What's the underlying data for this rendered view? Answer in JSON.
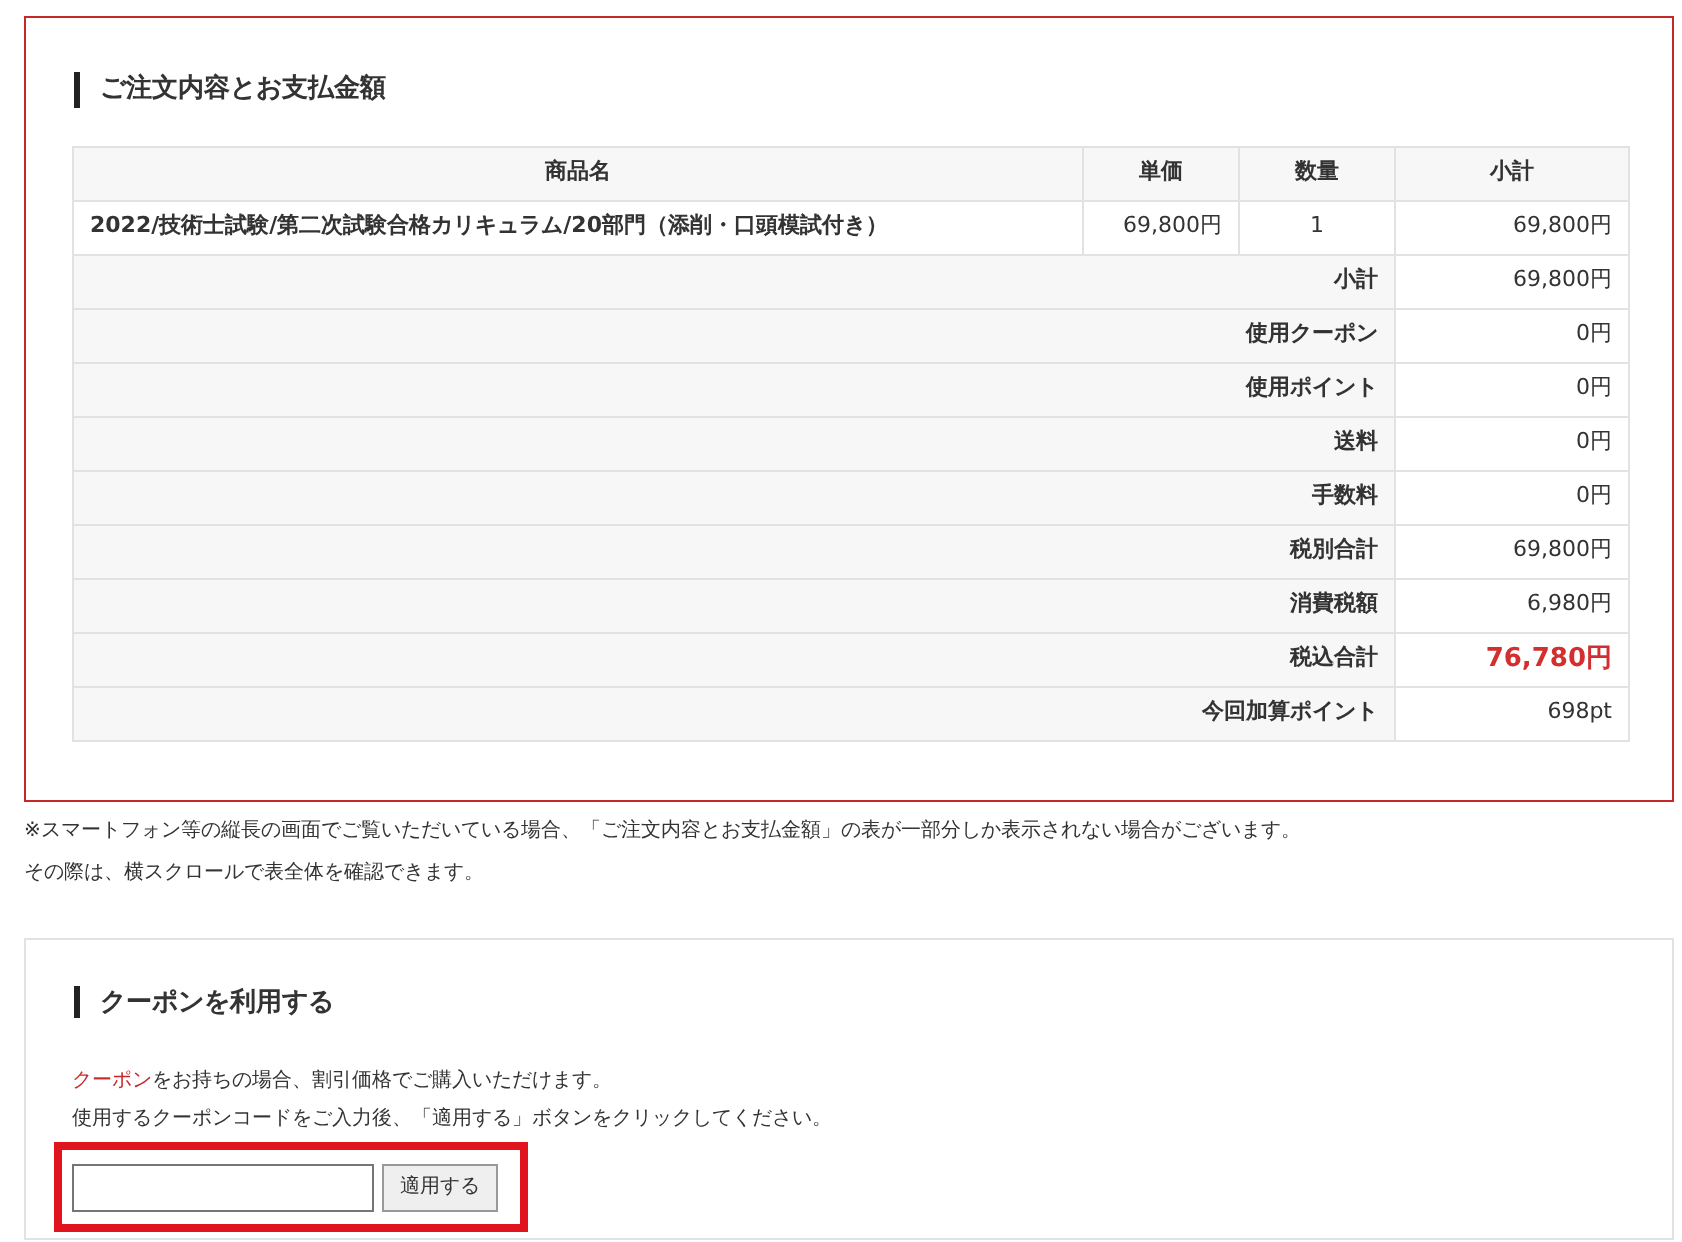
{
  "order": {
    "title": "ご注文内容とお支払金額",
    "columns": [
      "商品名",
      "単価",
      "数量",
      "小計"
    ],
    "items": [
      {
        "name": "2022/技術士試験/第二次試験合格カリキュラム/20部門（添削・口頭模試付き）",
        "price": "69,800円",
        "quantity": "1",
        "subtotal": "69,800円"
      }
    ],
    "summary": [
      {
        "label": "小計",
        "value": "69,800円",
        "highlight": false
      },
      {
        "label": "使用クーポン",
        "value": "0円",
        "highlight": false
      },
      {
        "label": "使用ポイント",
        "value": "0円",
        "highlight": false
      },
      {
        "label": "送料",
        "value": "0円",
        "highlight": false
      },
      {
        "label": "手数料",
        "value": "0円",
        "highlight": false
      },
      {
        "label": "税別合計",
        "value": "69,800円",
        "highlight": false
      },
      {
        "label": "消費税額",
        "value": "6,980円",
        "highlight": false
      },
      {
        "label": "税込合計",
        "value": "76,780円",
        "highlight": true
      },
      {
        "label": "今回加算ポイント",
        "value": "698pt",
        "highlight": false
      }
    ]
  },
  "notes": [
    "※スマートフォン等の縦長の画面でご覧いただいている場合、「ご注文内容とお支払金額」の表が一部分しか表示されない場合がございます。",
    "その際は、横スクロールで表全体を確認できます。"
  ],
  "coupon": {
    "title": "クーポンを利用する",
    "link": "クーポン",
    "intro": "をお持ちの場合、割引価格でご購入いただけます。",
    "instruction": "使用するクーポンコードをご入力後、「適用する」ボタンをクリックしてください。",
    "button": "適用する"
  }
}
